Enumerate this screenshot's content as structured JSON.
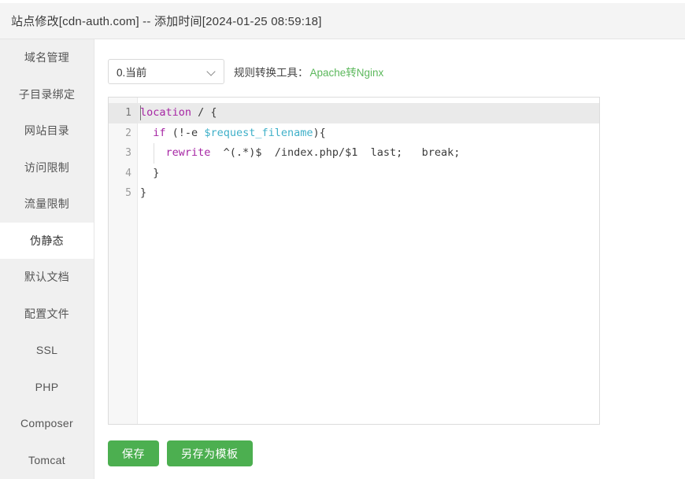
{
  "window": {
    "title": "站点修改[cdn-auth.com] -- 添加时间[2024-01-25 08:59:18]"
  },
  "sidebar": {
    "items": [
      {
        "label": "域名管理",
        "active": false
      },
      {
        "label": "子目录绑定",
        "active": false
      },
      {
        "label": "网站目录",
        "active": false
      },
      {
        "label": "访问限制",
        "active": false
      },
      {
        "label": "流量限制",
        "active": false
      },
      {
        "label": "伪静态",
        "active": true
      },
      {
        "label": "默认文档",
        "active": false
      },
      {
        "label": "配置文件",
        "active": false
      },
      {
        "label": "SSL",
        "active": false
      },
      {
        "label": "PHP",
        "active": false
      },
      {
        "label": "Composer",
        "active": false
      },
      {
        "label": "Tomcat",
        "active": false
      }
    ]
  },
  "toolbar": {
    "select_value": "0.当前",
    "select_options": [
      "0.当前"
    ],
    "convert_label": "规则转换工具：",
    "convert_link": "Apache转Nginx",
    "link_color": "#5cb85c"
  },
  "editor": {
    "line_numbers": [
      "1",
      "2",
      "3",
      "4",
      "5"
    ],
    "active_line": 1,
    "lines": [
      {
        "number": "1",
        "text": "location / {",
        "tokens": [
          {
            "t": "location",
            "c": "keyword"
          },
          {
            "t": " / {",
            "c": "plain"
          }
        ]
      },
      {
        "number": "2",
        "text": "  if (!-e $request_filename){",
        "tokens": [
          {
            "t": "  ",
            "c": "plain"
          },
          {
            "t": "if",
            "c": "keyword"
          },
          {
            "t": " (!-e ",
            "c": "plain"
          },
          {
            "t": "$request_filename",
            "c": "var"
          },
          {
            "t": "){",
            "c": "plain"
          }
        ]
      },
      {
        "number": "3",
        "text": "    rewrite  ^(.*)$  /index.php/$1  last;   break;",
        "tokens": [
          {
            "t": "    ",
            "c": "plain"
          },
          {
            "t": "rewrite",
            "c": "keyword"
          },
          {
            "t": "  ^(.*)$  /index.php/$1  last;   break;",
            "c": "plain"
          }
        ]
      },
      {
        "number": "4",
        "text": "  }",
        "tokens": [
          {
            "t": "  }",
            "c": "plain"
          }
        ]
      },
      {
        "number": "5",
        "text": "}",
        "tokens": [
          {
            "t": "}",
            "c": "plain"
          }
        ]
      }
    ]
  },
  "buttons": {
    "save": "保存",
    "save_as_template": "另存为模板",
    "color": "#4caf50"
  }
}
